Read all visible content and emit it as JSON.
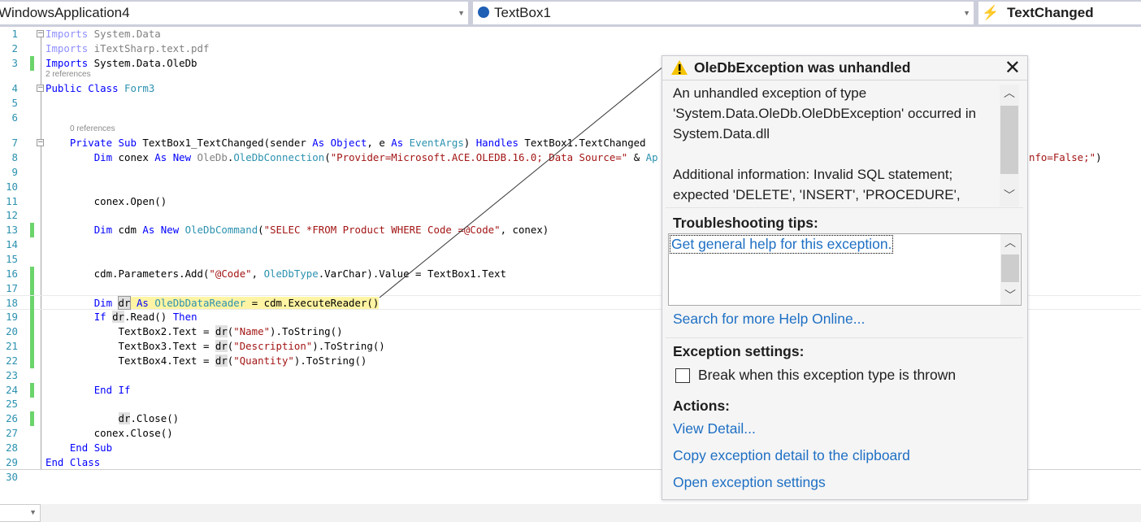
{
  "nav": {
    "project": "WindowsApplication4",
    "object": "TextBox1",
    "event": "TextChanged"
  },
  "codelens": {
    "class_refs": "2 references",
    "sub_refs": "0 references"
  },
  "code": [
    {
      "n": "1",
      "t": [
        [
          "Imports",
          "gk"
        ],
        [
          " System.Data",
          "gr"
        ]
      ]
    },
    {
      "n": "2",
      "t": [
        [
          "Imports",
          "gk"
        ],
        [
          " iTextSharp.text.pdf",
          "gr"
        ]
      ]
    },
    {
      "n": "3",
      "t": [
        [
          "Imports",
          "kw"
        ],
        [
          " System.Data.OleDb",
          "id"
        ]
      ]
    },
    {
      "n": "4",
      "t": [
        [
          "Public",
          "kw"
        ],
        [
          " ",
          "id"
        ],
        [
          "Class",
          "kw"
        ],
        [
          " ",
          "id"
        ],
        [
          "Form3",
          "ty"
        ]
      ]
    },
    {
      "n": "5",
      "t": []
    },
    {
      "n": "6",
      "t": []
    },
    {
      "n": "7",
      "t": [
        [
          "    ",
          "id"
        ],
        [
          "Private",
          "kw"
        ],
        [
          " ",
          "id"
        ],
        [
          "Sub",
          "kw"
        ],
        [
          " TextBox1_TextChanged(sender ",
          "id"
        ],
        [
          "As",
          "kw"
        ],
        [
          " ",
          "id"
        ],
        [
          "Object",
          "kw"
        ],
        [
          ", e ",
          "id"
        ],
        [
          "As",
          "kw"
        ],
        [
          " ",
          "id"
        ],
        [
          "EventArgs",
          "ty"
        ],
        [
          ") ",
          "id"
        ],
        [
          "Handles",
          "kw"
        ],
        [
          " TextBox1.TextChanged",
          "id"
        ]
      ]
    },
    {
      "n": "8",
      "t": [
        [
          "        ",
          "id"
        ],
        [
          "Dim",
          "kw"
        ],
        [
          " conex ",
          "id"
        ],
        [
          "As",
          "kw"
        ],
        [
          " ",
          "id"
        ],
        [
          "New",
          "kw"
        ],
        [
          " ",
          "id"
        ],
        [
          "OleDb",
          "gr"
        ],
        [
          ".",
          "id"
        ],
        [
          "OleDbConnection",
          "ty"
        ],
        [
          "(",
          "id"
        ],
        [
          "\"Provider=Microsoft.ACE.OLEDB.16.0; Data Source=\"",
          "st"
        ],
        [
          " & ",
          "id"
        ],
        [
          "Ap",
          "ty"
        ]
      ],
      "tail": [
        [
          "nfo=False;\"",
          "st"
        ],
        [
          ")",
          "id"
        ]
      ]
    },
    {
      "n": "9",
      "t": []
    },
    {
      "n": "10",
      "t": []
    },
    {
      "n": "11",
      "t": [
        [
          "        conex.Open()",
          "id"
        ]
      ]
    },
    {
      "n": "12",
      "t": []
    },
    {
      "n": "13",
      "t": [
        [
          "        ",
          "id"
        ],
        [
          "Dim",
          "kw"
        ],
        [
          " cdm ",
          "id"
        ],
        [
          "As",
          "kw"
        ],
        [
          " ",
          "id"
        ],
        [
          "New",
          "kw"
        ],
        [
          " ",
          "id"
        ],
        [
          "OleDbCommand",
          "ty"
        ],
        [
          "(",
          "id"
        ],
        [
          "\"SELEC *FROM Product WHERE Code =@Code\"",
          "st"
        ],
        [
          ", conex)",
          "id"
        ]
      ]
    },
    {
      "n": "14",
      "t": []
    },
    {
      "n": "15",
      "t": []
    },
    {
      "n": "16",
      "t": [
        [
          "        cdm.Parameters.Add(",
          "id"
        ],
        [
          "\"@Code\"",
          "st"
        ],
        [
          ", ",
          "id"
        ],
        [
          "OleDbType",
          "ty"
        ],
        [
          ".VarChar).Value = TextBox1.Text",
          "id"
        ]
      ]
    },
    {
      "n": "17",
      "t": []
    },
    {
      "n": "18",
      "t": [
        [
          "        ",
          "id"
        ],
        [
          "Dim",
          "kw"
        ],
        [
          " ",
          "id"
        ],
        [
          "dr",
          "ref"
        ],
        [
          " ",
          "hl"
        ],
        [
          "As",
          "kwhl"
        ],
        [
          " ",
          "hl"
        ],
        [
          "OleDbDataReader",
          "tyhl"
        ],
        [
          " = cdm.ExecuteReader()",
          "hl"
        ]
      ]
    },
    {
      "n": "19",
      "t": [
        [
          "        ",
          "id"
        ],
        [
          "If",
          "kw"
        ],
        [
          " ",
          "id"
        ],
        [
          "dr",
          "ref"
        ],
        [
          ".Read() ",
          "id"
        ],
        [
          "Then",
          "kw"
        ]
      ]
    },
    {
      "n": "20",
      "t": [
        [
          "            TextBox2.Text = ",
          "id"
        ],
        [
          "dr",
          "ref"
        ],
        [
          "(",
          "id"
        ],
        [
          "\"Name\"",
          "st"
        ],
        [
          ").ToString()",
          "id"
        ]
      ]
    },
    {
      "n": "21",
      "t": [
        [
          "            TextBox3.Text = ",
          "id"
        ],
        [
          "dr",
          "ref"
        ],
        [
          "(",
          "id"
        ],
        [
          "\"Description\"",
          "st"
        ],
        [
          ").ToString()",
          "id"
        ]
      ]
    },
    {
      "n": "22",
      "t": [
        [
          "            TextBox4.Text = ",
          "id"
        ],
        [
          "dr",
          "ref"
        ],
        [
          "(",
          "id"
        ],
        [
          "\"Quantity\"",
          "st"
        ],
        [
          ").ToString()",
          "id"
        ]
      ]
    },
    {
      "n": "23",
      "t": []
    },
    {
      "n": "24",
      "t": [
        [
          "        ",
          "id"
        ],
        [
          "End",
          "kw"
        ],
        [
          " ",
          "id"
        ],
        [
          "If",
          "kw"
        ]
      ]
    },
    {
      "n": "25",
      "t": []
    },
    {
      "n": "26",
      "t": [
        [
          "            ",
          "id"
        ],
        [
          "dr",
          "ref"
        ],
        [
          ".Close()",
          "id"
        ]
      ]
    },
    {
      "n": "27",
      "t": [
        [
          "        conex.Close()",
          "id"
        ]
      ]
    },
    {
      "n": "28",
      "t": [
        [
          "    ",
          "id"
        ],
        [
          "End",
          "kw"
        ],
        [
          " ",
          "id"
        ],
        [
          "Sub",
          "kw"
        ]
      ]
    },
    {
      "n": "29",
      "t": [
        [
          "End",
          "kw"
        ],
        [
          " ",
          "id"
        ],
        [
          "Class",
          "kw"
        ]
      ]
    },
    {
      "n": "30",
      "t": []
    }
  ],
  "dialog": {
    "title": "OleDbException was unhandled",
    "message_1": "An unhandled exception of type 'System.Data.OleDb.OleDbException' occurred in System.Data.dll",
    "message_2": "Additional information: Invalid SQL statement; expected 'DELETE', 'INSERT', 'PROCEDURE',",
    "tips_heading": "Troubleshooting tips:",
    "tip_link": "Get general help for this exception.",
    "search_link": "Search for more Help Online...",
    "settings_heading": "Exception settings:",
    "break_checkbox": "Break when this exception type is thrown",
    "break_checked": false,
    "actions_heading": "Actions:",
    "actions": [
      "View Detail...",
      "Copy exception detail to the clipboard",
      "Open exception settings"
    ]
  },
  "colors": {
    "keyword": "#0000ff",
    "type": "#2b91af",
    "string": "#a31515",
    "highlight": "#fff4a3",
    "link": "#1e6fc4",
    "change_bar": "#6bd46b"
  }
}
